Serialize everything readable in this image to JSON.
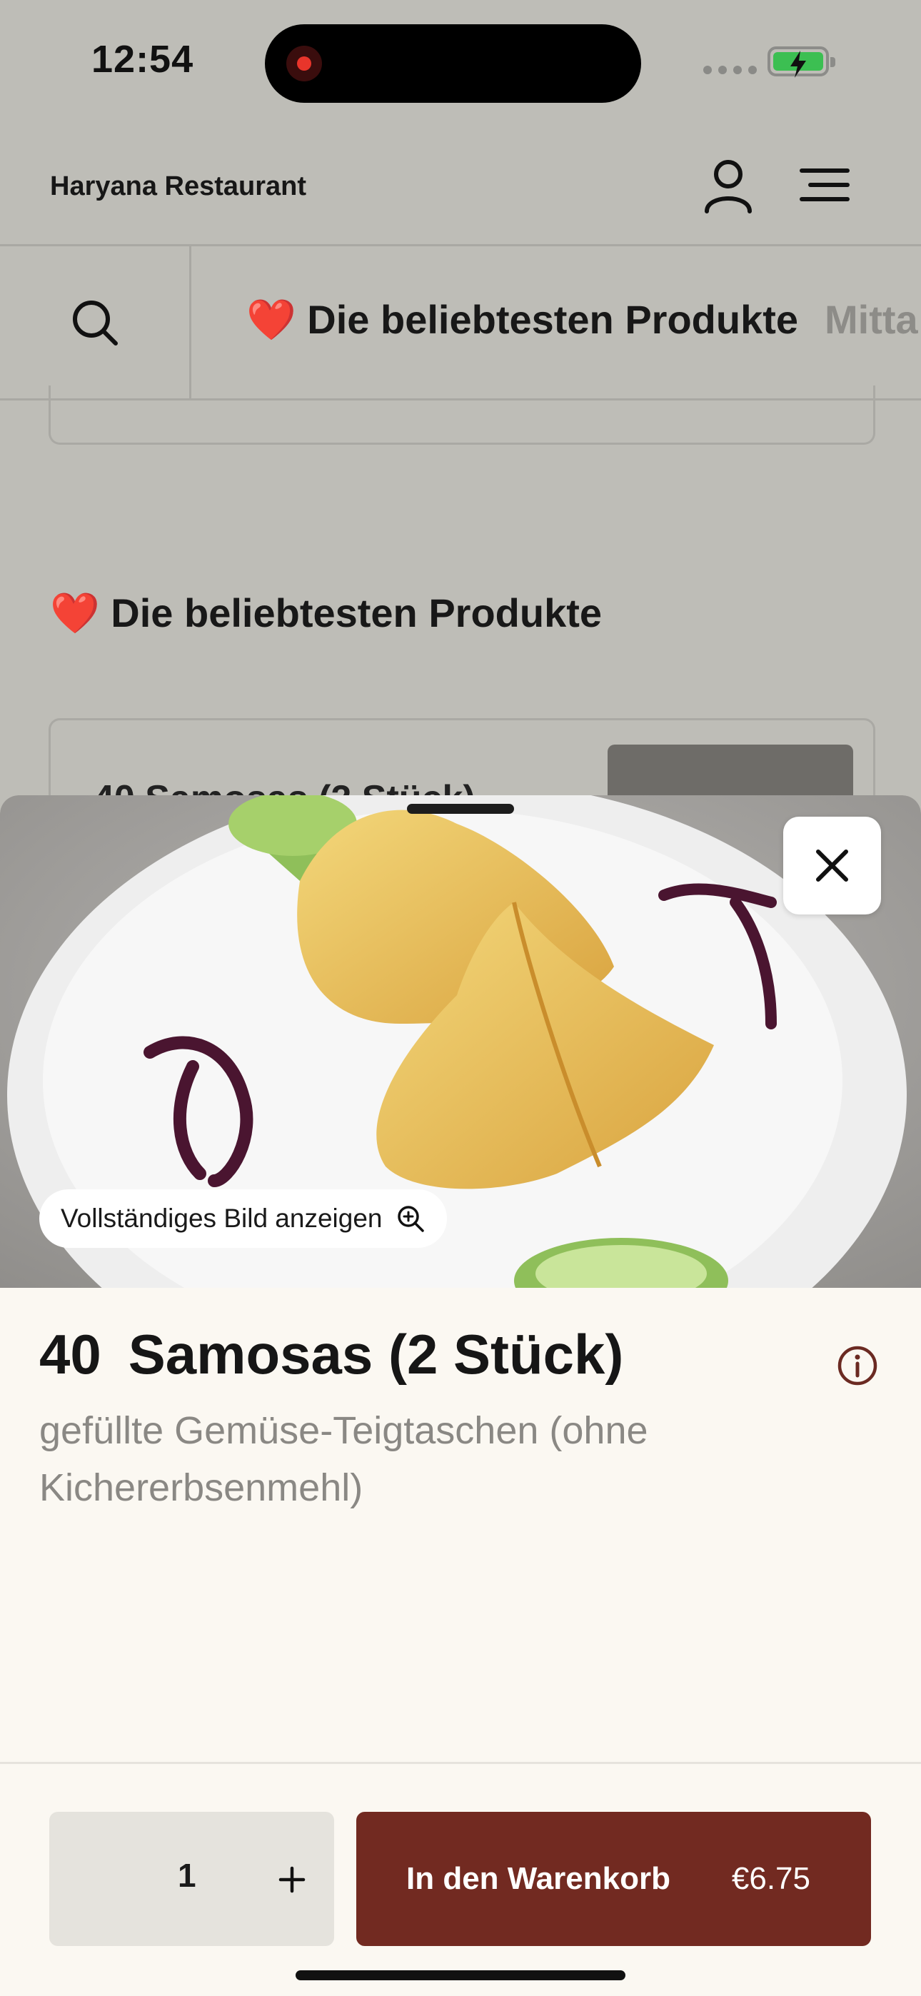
{
  "status_bar": {
    "time": "12:54"
  },
  "header": {
    "restaurant_name": "Haryana Restaurant"
  },
  "category_bar": {
    "active_tab": {
      "emoji": "❤️",
      "label": "Die beliebtesten Produkte"
    },
    "next_tab": "Mitta"
  },
  "section": {
    "emoji": "❤️",
    "title": "Die beliebtesten Produkte"
  },
  "background_card": {
    "name": "40  Samosas (2 Stück)"
  },
  "product": {
    "number": "40",
    "name": "Samosas (2 Stück)",
    "description": "gefüllte Gemüse-Teigtaschen (ohne Kichererbsenmehl)",
    "show_full_image_label": "Vollständiges Bild anzeigen"
  },
  "quantity": {
    "value": "1",
    "plus": "+"
  },
  "cart": {
    "label": "In den Warenkorb",
    "price": "€6.75"
  },
  "colors": {
    "accent": "#722a21",
    "sheet_bg": "#fbf8f2",
    "overlay": "#bebdb7"
  },
  "icons": [
    "user-icon",
    "menu-icon",
    "search-icon",
    "close-icon",
    "zoom-in-icon",
    "info-icon"
  ]
}
